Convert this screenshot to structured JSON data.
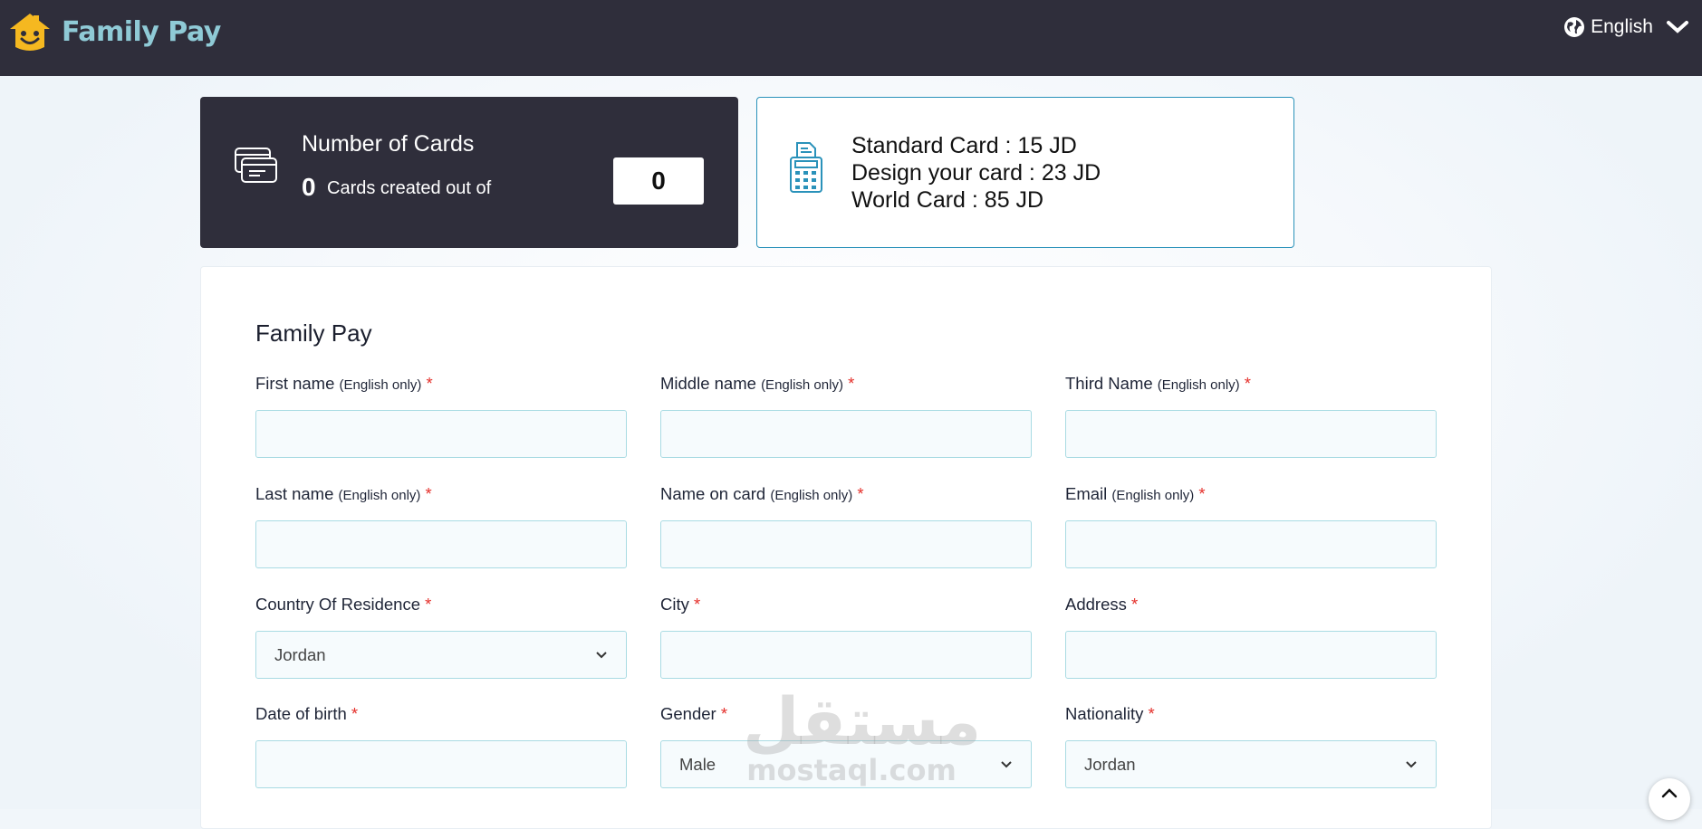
{
  "header": {
    "app_name": "Family Pay",
    "language": "English"
  },
  "cards_summary": {
    "title": "Number of Cards",
    "created_count": "0",
    "created_label": "Cards created out of",
    "total": "0"
  },
  "pricing": {
    "lines": [
      "Standard Card : 15 JD",
      "Design your card : 23 JD",
      "World Card : 85 JD"
    ]
  },
  "form": {
    "title": "Family Pay",
    "hint": "(English only)",
    "required_mark": "*",
    "fields": {
      "first_name": {
        "label": "First name",
        "value": ""
      },
      "middle_name": {
        "label": "Middle name",
        "value": ""
      },
      "third_name": {
        "label": "Third Name",
        "value": ""
      },
      "last_name": {
        "label": "Last name",
        "value": ""
      },
      "name_on_card": {
        "label": "Name on card",
        "value": ""
      },
      "email": {
        "label": "Email",
        "value": ""
      },
      "country": {
        "label": "Country Of Residence",
        "value": "Jordan"
      },
      "city": {
        "label": "City",
        "value": ""
      },
      "address": {
        "label": "Address",
        "value": ""
      },
      "dob": {
        "label": "Date of birth",
        "value": ""
      },
      "gender": {
        "label": "Gender",
        "value": "Male"
      },
      "nationality": {
        "label": "Nationality",
        "value": "Jordan"
      }
    }
  },
  "watermark": {
    "arabic": "مستقل",
    "latin": "mostaql.com"
  },
  "colors": {
    "topbar": "#2f2e3b",
    "logo_text": "#8fcad6",
    "logo_yellow": "#f5b820",
    "accent_border": "#2a92ba",
    "required": "#e5322d"
  }
}
